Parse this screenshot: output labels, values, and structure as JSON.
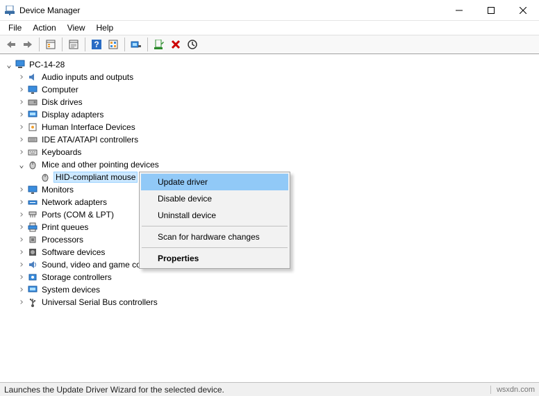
{
  "window": {
    "title": "Device Manager"
  },
  "menubar": {
    "file": "File",
    "action": "Action",
    "view": "View",
    "help": "Help"
  },
  "tree": {
    "root": "PC-14-28",
    "items": [
      {
        "label": "Audio inputs and outputs",
        "icon": "audio"
      },
      {
        "label": "Computer",
        "icon": "computer"
      },
      {
        "label": "Disk drives",
        "icon": "disk"
      },
      {
        "label": "Display adapters",
        "icon": "display"
      },
      {
        "label": "Human Interface Devices",
        "icon": "hid"
      },
      {
        "label": "IDE ATA/ATAPI controllers",
        "icon": "ide"
      },
      {
        "label": "Keyboards",
        "icon": "keyboard"
      },
      {
        "label": "Mice and other pointing devices",
        "icon": "mouse",
        "expanded": true,
        "children": [
          {
            "label": "HID-compliant mouse"
          }
        ]
      },
      {
        "label": "Monitors",
        "icon": "monitor"
      },
      {
        "label": "Network adapters",
        "icon": "network"
      },
      {
        "label": "Ports (COM & LPT)",
        "icon": "ports"
      },
      {
        "label": "Print queues",
        "icon": "print"
      },
      {
        "label": "Processors",
        "icon": "cpu"
      },
      {
        "label": "Software devices",
        "icon": "software"
      },
      {
        "label": "Sound, video and game controllers",
        "icon": "sound"
      },
      {
        "label": "Storage controllers",
        "icon": "storage"
      },
      {
        "label": "System devices",
        "icon": "system"
      },
      {
        "label": "Universal Serial Bus controllers",
        "icon": "usb"
      }
    ],
    "selected_child": "HID-compliant mouse"
  },
  "context_menu": {
    "update": "Update driver",
    "disable": "Disable device",
    "uninstall": "Uninstall device",
    "scan": "Scan for hardware changes",
    "properties": "Properties"
  },
  "statusbar": {
    "text": "Launches the Update Driver Wizard for the selected device.",
    "brand": "wsxdn.com"
  }
}
